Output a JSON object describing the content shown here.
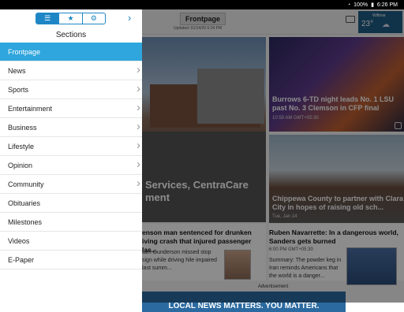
{
  "status": {
    "battery": "100%",
    "time": "6:26 PM"
  },
  "page": {
    "title": "Frontpage",
    "updated": "Updated: 01/14/20 6:24 PM",
    "weather": {
      "city": "Willmar",
      "temp": "23°"
    },
    "lead_caption": "Services, CentraCare\nment",
    "sports": {
      "caption": "Burrows 6-TD night leads No. 1 LSU past No. 3 Clemson in CFP final",
      "time": "10:59 AM GMT+05:30"
    },
    "county": {
      "caption": "Chippewa County to partner with Clara City in hopes of raising old sch...",
      "time": "Tue, Jan 14"
    },
    "story1": {
      "headline": "enson man sentenced for drunken iving crash that injured passenger las...",
      "summary": "tam Gunderson missed stop sign while driving hile impaired last summ..."
    },
    "story2": {
      "headline": "Ruben Navarrette: In a dangerous world, Sanders gets burned",
      "time": "6:00 PM GMT+05:30",
      "summary": "Summary: The powder keg in Iran reminds Americans that the world is a danger..."
    },
    "ad_label": "Advertisement",
    "ad_text": "LOCAL NEWS MATTERS. YOU MATTER."
  },
  "drawer": {
    "tabs": [
      {
        "icon": "list-icon",
        "glyph": "☰"
      },
      {
        "icon": "star-icon",
        "glyph": "★"
      },
      {
        "icon": "gear-icon",
        "glyph": "⚙"
      }
    ],
    "close_glyph": "›",
    "heading": "Sections",
    "items": [
      {
        "label": "Frontpage",
        "active": true,
        "chevron": false
      },
      {
        "label": "News",
        "chevron": true
      },
      {
        "label": "Sports",
        "chevron": true
      },
      {
        "label": "Entertainment",
        "chevron": true
      },
      {
        "label": "Business",
        "chevron": true
      },
      {
        "label": "Lifestyle",
        "chevron": true
      },
      {
        "label": "Opinion",
        "chevron": true
      },
      {
        "label": "Community",
        "chevron": true
      },
      {
        "label": "Obituaries",
        "chevron": false
      },
      {
        "label": "Milestones",
        "chevron": false
      },
      {
        "label": "Videos",
        "chevron": false
      },
      {
        "label": "E-Paper",
        "chevron": false
      }
    ],
    "accent": "#1f86c6",
    "active_bg": "#2fa6dd"
  }
}
